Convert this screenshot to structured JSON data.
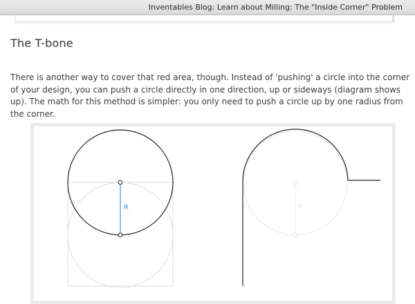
{
  "window": {
    "title": "Inventables Blog: Learn about Milling: The \"Inside Corner\" Problem"
  },
  "article": {
    "heading": "The T-bone",
    "paragraph": "There is another way to cover that red area, though. Instead of 'pushing' a circle into the corner of your design, you can push a circle directly in one direction, up or sideways (diagram shows up). The math for this method is simpler: you only need to push a circle up by one radius from the corner."
  },
  "diagram": {
    "left_radius_label": "R",
    "right_radius_label": "R",
    "colors": {
      "line": "#222222",
      "faint": "#dddddd",
      "radius": "#3a9ad9"
    }
  }
}
